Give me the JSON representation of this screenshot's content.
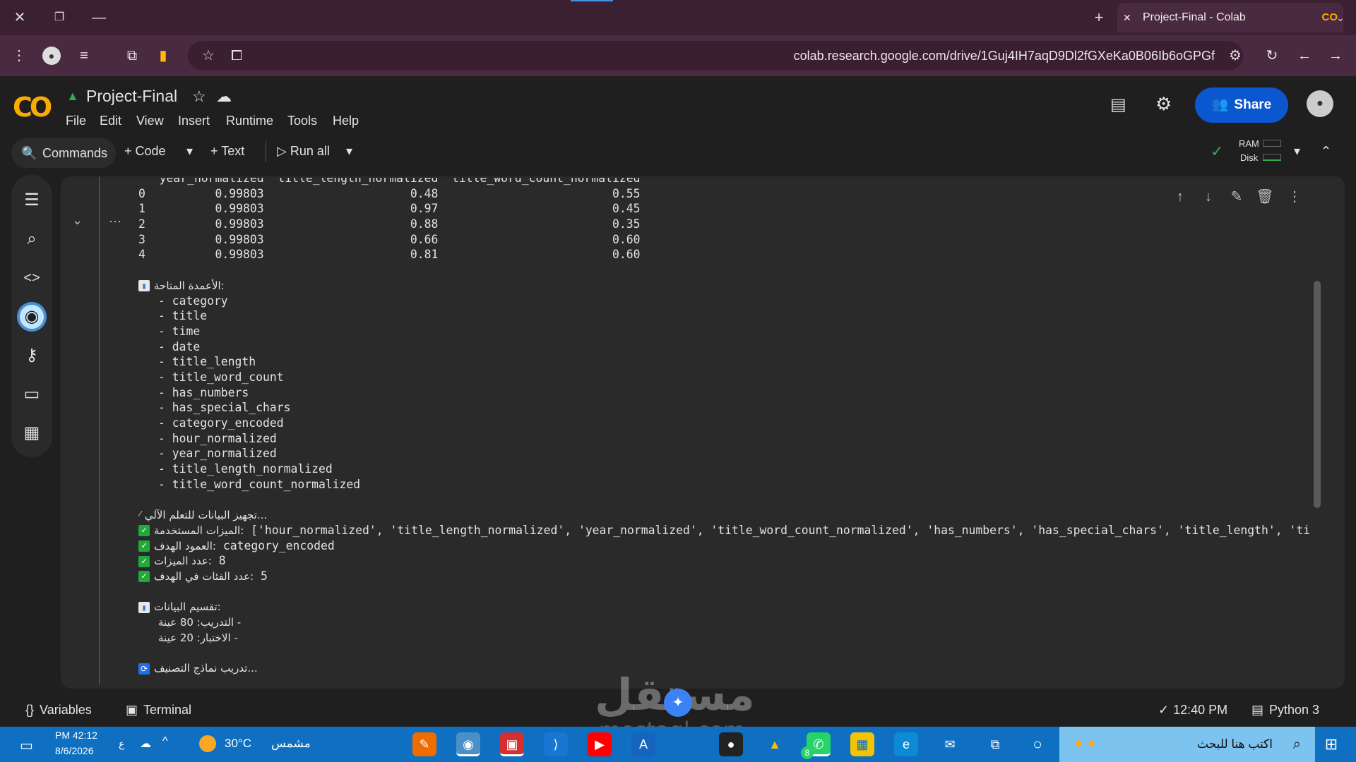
{
  "browser": {
    "tab_title": "Project-Final - Colab",
    "url": "colab.research.google.com/drive/1Guj4IH7aqD9Dl2fGXeKa0B06Ib6oGPGf"
  },
  "colab": {
    "logo": "CO",
    "notebook_title": "Project-Final",
    "menu": [
      "File",
      "Edit",
      "View",
      "Insert",
      "Runtime",
      "Tools",
      "Help"
    ],
    "share_label": "Share",
    "toolbar": {
      "commands": "Commands",
      "code": "Code",
      "text": "Text",
      "run_all": "Run all",
      "ram": "RAM",
      "disk": "Disk"
    }
  },
  "output": {
    "table_header": "   year_normalized  title_length_normalized  title_word_count_normalized",
    "table_rows": [
      "0          0.99803                     0.48                         0.55",
      "1          0.99803                     0.97                         0.45",
      "2          0.99803                     0.88                         0.35",
      "3          0.99803                     0.66                         0.60",
      "4          0.99803                     0.81                         0.60"
    ],
    "columns_heading": ":الأعمدة المتاحة",
    "columns": [
      "- category",
      "- title",
      "- time",
      "- date",
      "- title_length",
      "- title_word_count",
      "- has_numbers",
      "- has_special_chars",
      "- category_encoded",
      "- hour_normalized",
      "- year_normalized",
      "- title_length_normalized",
      "- title_word_count_normalized"
    ],
    "prep_heading": "...تجهيز البيانات للتعلم الآلي",
    "features_label": ":الميزات المستخدمة",
    "features_value": " ['hour_normalized', 'title_length_normalized', 'year_normalized', 'title_word_count_normalized', 'has_numbers', 'has_special_chars', 'title_length', 'title_",
    "target_label": ":العمود الهدف",
    "target_value": " category_encoded",
    "n_features_label": ":عدد الميزات",
    "n_features_value": " 8",
    "n_classes_label": ":عدد الفئات في الهدف",
    "n_classes_value": " 5",
    "split_heading": ":تقسيم البيانات",
    "train_line": "- التدريب: 80 عينة",
    "test_line": "- الاختبار: 20 عينة",
    "training_heading": "...تدريب نماذج التصنيف"
  },
  "statusbar": {
    "variables": "Variables",
    "terminal": "Terminal",
    "time": "12:40 PM",
    "runtime": "Python 3"
  },
  "taskbar": {
    "search_placeholder": "اكتب هنا للبحث",
    "weather_temp": "30°C",
    "weather_text": "مشمس",
    "clock_time": "PM 42:12",
    "clock_date": "8/6/2026",
    "lang": "ع",
    "whatsapp_badge": "8"
  },
  "watermark": {
    "brand": "مستقل",
    "domain": "mostaql.com"
  }
}
